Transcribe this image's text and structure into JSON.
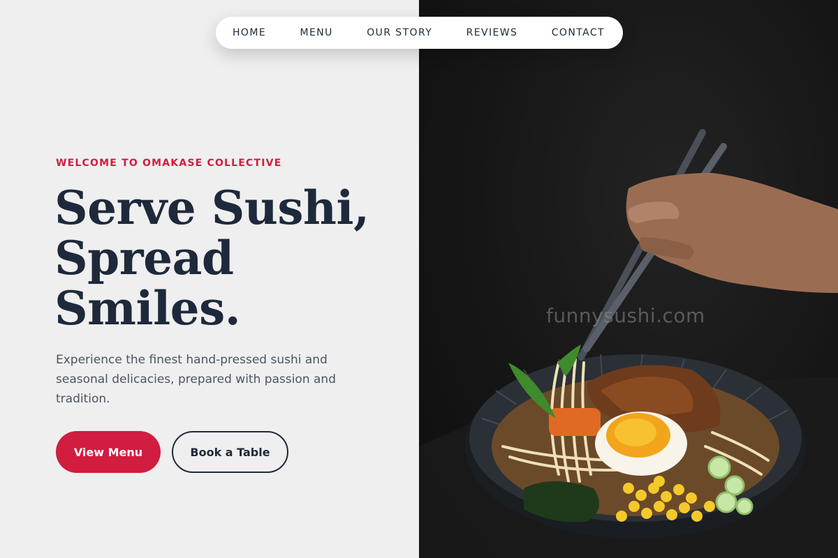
{
  "nav": {
    "items": [
      {
        "label": "HOME"
      },
      {
        "label": "MENU"
      },
      {
        "label": "OUR STORY"
      },
      {
        "label": "REVIEWS"
      },
      {
        "label": "CONTACT"
      }
    ]
  },
  "hero": {
    "eyebrow": "WELCOME TO OMAKASE COLLECTIVE",
    "headline_lines": [
      "Serve Sushi,",
      "Spread",
      "Smiles."
    ],
    "lede": "Experience the finest hand-pressed sushi and seasonal delicacies, prepared with passion and tradition.",
    "primary_cta": "View Menu",
    "secondary_cta": "Book a Table"
  },
  "watermark": "funnysushi.com",
  "colors": {
    "accent": "#d11d3f",
    "heading": "#1e293b",
    "body_text": "#4b5563",
    "left_background": "#efefef",
    "photo_background": "#161616"
  }
}
